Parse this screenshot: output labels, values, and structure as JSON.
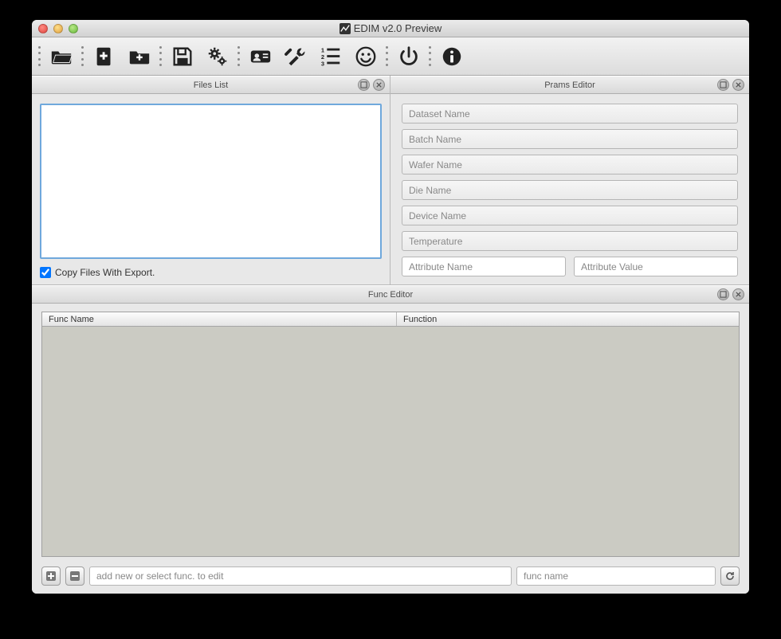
{
  "window": {
    "title": "EDIM v2.0 Preview"
  },
  "toolbar": {
    "icons": [
      "open-folder",
      "new-file",
      "new-folder",
      "save",
      "gears",
      "badge",
      "tools",
      "list-numbered",
      "smiley",
      "power",
      "info"
    ]
  },
  "filesPanel": {
    "title": "Files List",
    "copyLabel": "Copy Files With Export.",
    "copyChecked": true
  },
  "pramsPanel": {
    "title": "Prams Editor",
    "fields": [
      "Dataset Name",
      "Batch Name",
      "Wafer Name",
      "Die Name",
      "Device Name",
      "Temperature"
    ],
    "attrName": "Attribute Name",
    "attrValue": "Attribute Value"
  },
  "funcPanel": {
    "title": "Func Editor",
    "col1": "Func Name",
    "col2": "Function",
    "addPlaceholder": "add new or select func. to edit",
    "namePlaceholder": "func name"
  }
}
